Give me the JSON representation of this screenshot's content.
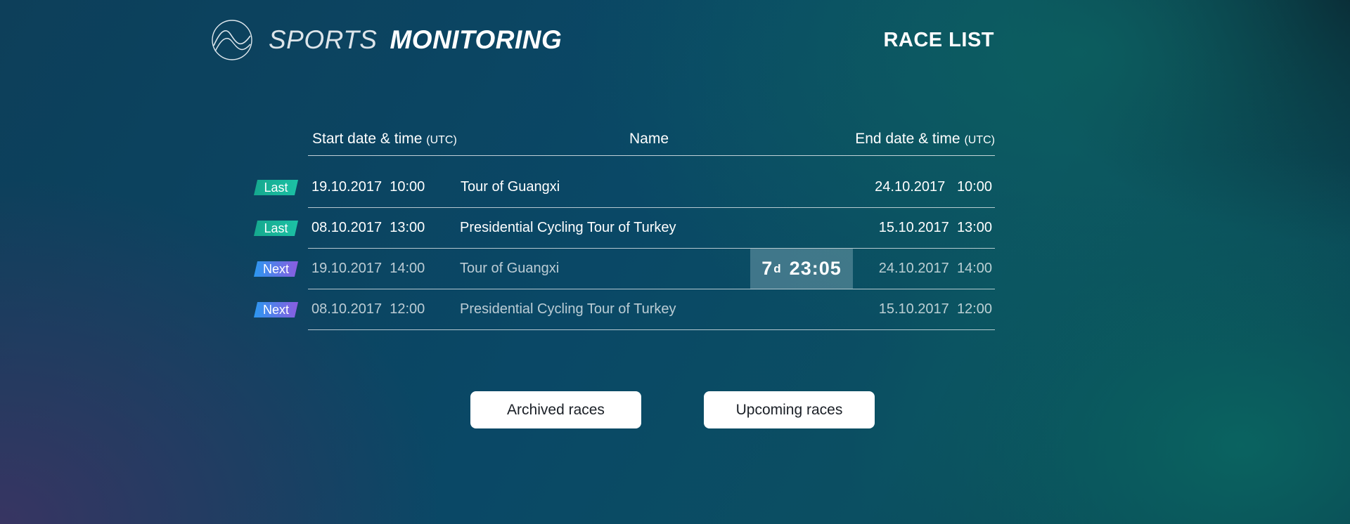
{
  "app": {
    "brand_light": "SPORTS",
    "brand_bold": "MONITORING",
    "logo_icon": "mountain-wave-icon",
    "page_title": "RACE LIST"
  },
  "table": {
    "headers": {
      "start": "Start date & time",
      "start_unit": "(UTC)",
      "name": "Name",
      "end": "End date & time",
      "end_unit": "(UTC)"
    },
    "rows": [
      {
        "badge": "Last",
        "start_date": "19.10.2017",
        "start_time": "10:00",
        "name": "Tour of Guangxi",
        "end_date": "24.10.2017",
        "end_time": "10:00"
      },
      {
        "badge": "Last",
        "start_date": "08.10.2017",
        "start_time": "13:00",
        "name": "Presidential Cycling Tour of Turkey",
        "end_date": "15.10.2017",
        "end_time": "13:00"
      },
      {
        "badge": "Next",
        "start_date": "19.10.2017",
        "start_time": "14:00",
        "name": "Tour of Guangxi",
        "end_date": "24.10.2017",
        "end_time": "14:00"
      },
      {
        "badge": "Next",
        "start_date": "08.10.2017",
        "start_time": "12:00",
        "name": "Presidential Cycling Tour of Turkey",
        "end_date": "15.10.2017",
        "end_time": "12:00"
      }
    ],
    "countdown": {
      "days": "7",
      "days_unit": "d",
      "time": "23:05"
    }
  },
  "actions": {
    "archived_label": "Archived races",
    "upcoming_label": "Upcoming races"
  },
  "colors": {
    "last_badge": "#1cc1a5",
    "next_badge_start": "#2b98f0",
    "next_badge_end": "#8b5ce0",
    "button_bg": "#ffffff"
  }
}
